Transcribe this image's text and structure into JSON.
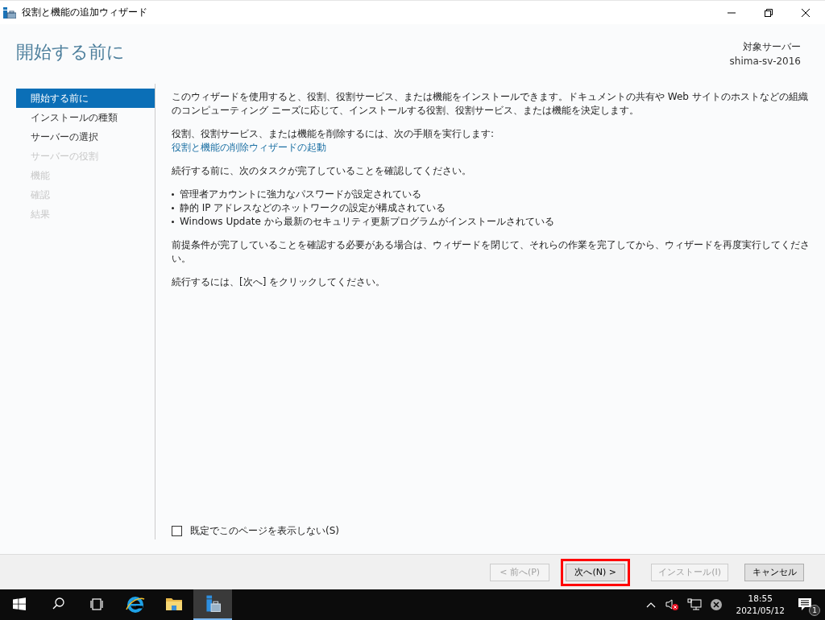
{
  "window": {
    "title": "役割と機能の追加ウィザード"
  },
  "header": {
    "title": "開始する前に",
    "target_label": "対象サーバー",
    "target_server": "shima-sv-2016"
  },
  "nav": [
    {
      "label": "開始する前に",
      "selected": true,
      "disabled": false
    },
    {
      "label": "インストールの種類",
      "selected": false,
      "disabled": false
    },
    {
      "label": "サーバーの選択",
      "selected": false,
      "disabled": false
    },
    {
      "label": "サーバーの役割",
      "selected": false,
      "disabled": true
    },
    {
      "label": "機能",
      "selected": false,
      "disabled": true
    },
    {
      "label": "確認",
      "selected": false,
      "disabled": true
    },
    {
      "label": "結果",
      "selected": false,
      "disabled": true
    }
  ],
  "content": [
    {
      "kind": "paragraph",
      "text": "このウィザードを使用すると、役割、役割サービス、または機能をインストールできます。ドキュメントの共有や Web サイトのホストなどの組織のコンピューティング ニーズに応じて、インストールする役割、役割サービス、または機能を決定します。"
    },
    {
      "kind": "paragraph",
      "text": "役割、役割サービス、または機能を削除するには、次の手順を実行します:",
      "link": "役割と機能の削除ウィザードの起動"
    },
    {
      "kind": "paragraph",
      "text": "続行する前に、次のタスクが完了していることを確認してください。"
    },
    {
      "kind": "bullets",
      "items": [
        "管理者アカウントに強力なパスワードが設定されている",
        "静的 IP アドレスなどのネットワークの設定が構成されている",
        "Windows Update から最新のセキュリティ更新プログラムがインストールされている"
      ]
    },
    {
      "kind": "paragraph",
      "text": "前提条件が完了していることを確認する必要がある場合は、ウィザードを閉じて、それらの作業を完了してから、ウィザードを再度実行してください。"
    },
    {
      "kind": "paragraph",
      "text": "続行するには、[次へ] をクリックしてください。"
    }
  ],
  "skip_checkbox": {
    "label": "既定でこのページを表示しない(S)",
    "checked": false
  },
  "buttons": [
    {
      "label": "< 前へ(P)",
      "disabled": true,
      "highlighted": false
    },
    {
      "label": "次へ(N) >",
      "disabled": false,
      "highlighted": true
    },
    {
      "label": "インストール(I)",
      "disabled": true,
      "highlighted": false
    },
    {
      "label": "キャンセル",
      "disabled": false,
      "highlighted": false
    }
  ],
  "taskbar": {
    "time": "18:55",
    "date": "2021/05/12",
    "notification_count": "1"
  }
}
